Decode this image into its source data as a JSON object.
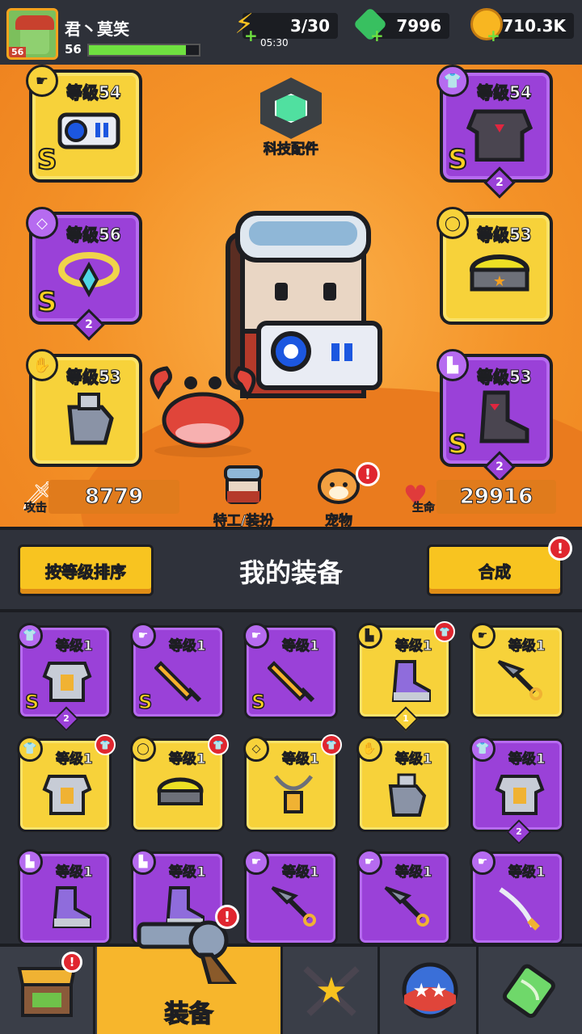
{
  "player": {
    "name": "君丶莫笑",
    "level": "56",
    "avatar_badge": "56",
    "xp_fraction": 0.88
  },
  "resources": {
    "energy": "3/30",
    "energy_timer": "05:30",
    "gems": "7996",
    "coins": "710.3K"
  },
  "hero": {
    "tech_label": "科技配件",
    "equipped": [
      {
        "slot": "weapon",
        "icon": "gun-icon",
        "level": "等级54",
        "rank": "S",
        "rarity": "yellow",
        "stars": ""
      },
      {
        "slot": "armor",
        "icon": "armor-icon",
        "level": "等级54",
        "rank": "S",
        "rarity": "purple",
        "stars": "2"
      },
      {
        "slot": "necklace",
        "icon": "necklace-icon",
        "level": "等级56",
        "rank": "S",
        "rarity": "purple",
        "stars": "2"
      },
      {
        "slot": "belt",
        "icon": "belt-icon",
        "level": "等级53",
        "rank": "",
        "rarity": "yellow",
        "stars": ""
      },
      {
        "slot": "gloves",
        "icon": "glove-icon",
        "level": "等级53",
        "rank": "",
        "rarity": "yellow",
        "stars": ""
      },
      {
        "slot": "boots",
        "icon": "boot-icon",
        "level": "等级53",
        "rank": "S",
        "rarity": "purple",
        "stars": "2"
      }
    ],
    "attack_label": "攻击",
    "attack_value": "8779",
    "health_label": "生命",
    "health_value": "29916",
    "agent_label": "特工/装扮",
    "pet_label": "宠物",
    "pet_alert": "!"
  },
  "section": {
    "sort_label": "按等级排序",
    "title": "我的装备",
    "merge_label": "合成",
    "merge_alert": "!"
  },
  "inventory": [
    {
      "icon": "armor-icon",
      "level": "等级1",
      "rank": "S",
      "rarity": "purple",
      "stars": "2",
      "new": false
    },
    {
      "icon": "sword-icon",
      "level": "等级1",
      "rank": "S",
      "rarity": "purple",
      "stars": "",
      "new": false
    },
    {
      "icon": "sword-icon",
      "level": "等级1",
      "rank": "S",
      "rarity": "purple",
      "stars": "",
      "new": false
    },
    {
      "icon": "boot-icon",
      "level": "等级1",
      "rank": "",
      "rarity": "yellow",
      "stars": "1",
      "new": true
    },
    {
      "icon": "kunai-icon",
      "level": "等级1",
      "rank": "",
      "rarity": "yellow",
      "stars": "",
      "new": false
    },
    {
      "icon": "armor-icon",
      "level": "等级1",
      "rank": "",
      "rarity": "yellow",
      "stars": "",
      "new": true
    },
    {
      "icon": "belt-icon",
      "level": "等级1",
      "rank": "",
      "rarity": "yellow",
      "stars": "",
      "new": true
    },
    {
      "icon": "necklace-icon",
      "level": "等级1",
      "rank": "",
      "rarity": "yellow",
      "stars": "",
      "new": true
    },
    {
      "icon": "glove-icon",
      "level": "等级1",
      "rank": "",
      "rarity": "yellow",
      "stars": "",
      "new": false
    },
    {
      "icon": "armor-icon",
      "level": "等级1",
      "rank": "",
      "rarity": "purple",
      "stars": "2",
      "new": false
    },
    {
      "icon": "boot-icon",
      "level": "等级1",
      "rank": "",
      "rarity": "purple",
      "stars": "",
      "new": false
    },
    {
      "icon": "boot-icon",
      "level": "等级1",
      "rank": "",
      "rarity": "purple",
      "stars": "",
      "new": false
    },
    {
      "icon": "kunai-icon",
      "level": "等级1",
      "rank": "",
      "rarity": "purple",
      "stars": "",
      "new": false
    },
    {
      "icon": "kunai-icon",
      "level": "等级1",
      "rank": "",
      "rarity": "purple",
      "stars": "",
      "new": false
    },
    {
      "icon": "katana-icon",
      "level": "等级1",
      "rank": "",
      "rarity": "purple",
      "stars": "",
      "new": false
    }
  ],
  "nav": {
    "shop_alert": "!",
    "equip_label": "装备",
    "equip_alert": "!"
  },
  "colors": {
    "yellow": "#f7d23a",
    "purple": "#9a41d8",
    "hero_bg": "#f49328",
    "panel": "#2b2e36"
  }
}
